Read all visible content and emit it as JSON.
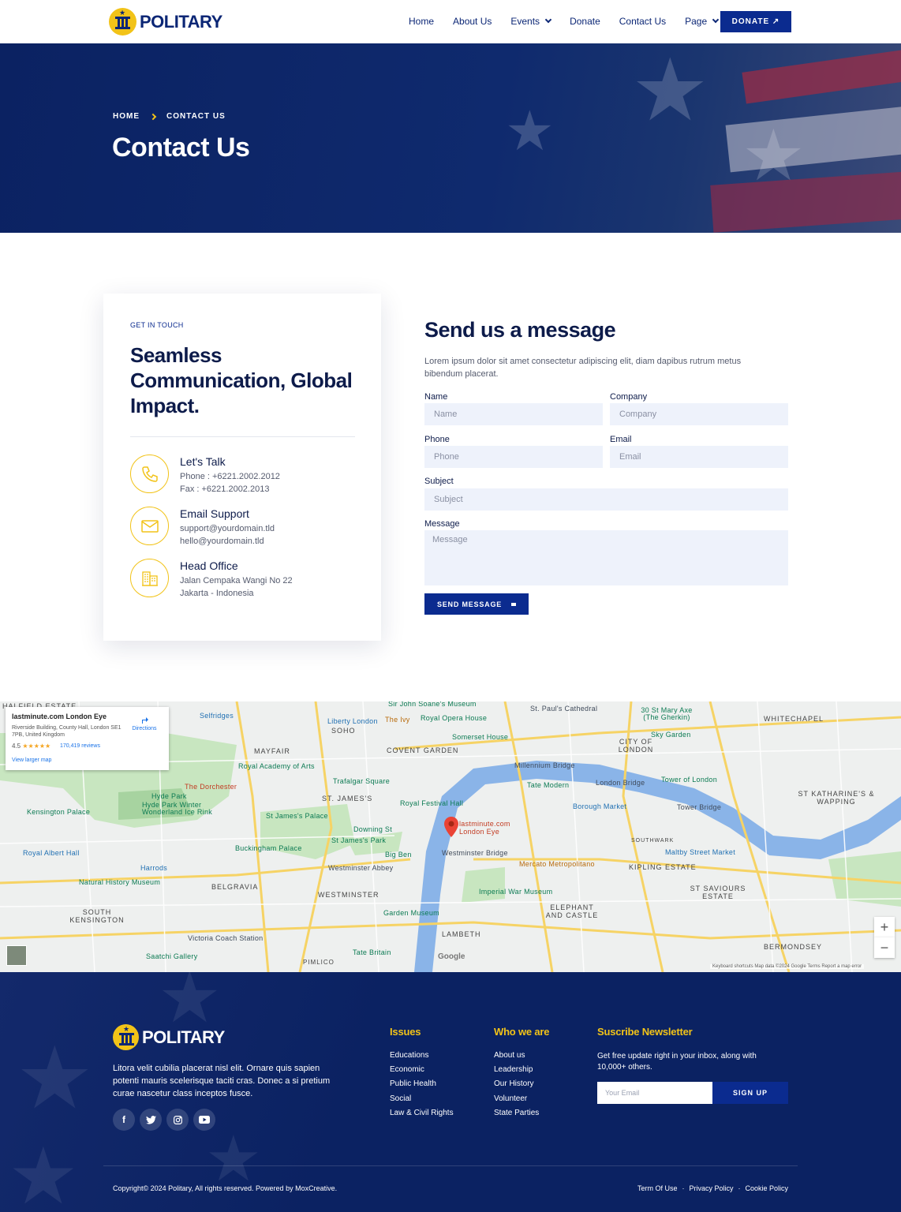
{
  "brand": {
    "name": "POLITARY"
  },
  "nav": {
    "items": [
      {
        "label": "Home",
        "dropdown": false
      },
      {
        "label": "About Us",
        "dropdown": false
      },
      {
        "label": "Events",
        "dropdown": true
      },
      {
        "label": "Donate",
        "dropdown": false
      },
      {
        "label": "Contact Us",
        "dropdown": false
      },
      {
        "label": "Page",
        "dropdown": true
      }
    ],
    "donate_label": "DONATE ↗"
  },
  "hero": {
    "breadcrumb": [
      "HOME",
      "CONTACT US"
    ],
    "title": "Contact Us"
  },
  "contact_card": {
    "eyebrow": "GET IN TOUCH",
    "heading": "Seamless Communication, Global Impact.",
    "items": [
      {
        "icon": "phone-icon",
        "title": "Let's Talk",
        "line1": "Phone : +6221.2002.2012",
        "line2": "Fax : +6221.2002.2013"
      },
      {
        "icon": "mail-icon",
        "title": "Email Support",
        "line1": "support@yourdomain.tld",
        "line2": "hello@yourdomain.tld"
      },
      {
        "icon": "building-icon",
        "title": "Head Office",
        "line1": "Jalan Cempaka Wangi No 22",
        "line2": "Jakarta - Indonesia"
      }
    ]
  },
  "form": {
    "title": "Send us a message",
    "description": "Lorem ipsum dolor sit amet consectetur adipiscing elit, diam dapibus rutrum metus bibendum placerat.",
    "fields": {
      "name": {
        "label": "Name",
        "placeholder": "Name"
      },
      "company": {
        "label": "Company",
        "placeholder": "Company"
      },
      "phone": {
        "label": "Phone",
        "placeholder": "Phone"
      },
      "email": {
        "label": "Email",
        "placeholder": "Email"
      },
      "subject": {
        "label": "Subject",
        "placeholder": "Subject"
      },
      "message": {
        "label": "Message",
        "placeholder": "Message"
      }
    },
    "submit_label": "SEND MESSAGE"
  },
  "map": {
    "place_name": "lastminute.com London Eye",
    "address": "Riverside Building, County Hall, London SE1 7PB, United Kingdom",
    "rating": "4.5",
    "stars": "★★★★★",
    "reviews": "170,419 reviews",
    "directions_label": "Directions",
    "view_larger": "View larger map",
    "pin_label": "lastminute.com London Eye",
    "zoom_in": "+",
    "zoom_out": "−",
    "footer": "Keyboard shortcuts    Map data ©2024 Google    Terms    Report a map error",
    "google": "Google",
    "labels": {
      "halfield": "HALFIELD ESTATE",
      "soho": "SOHO",
      "mayfair": "MAYFAIR",
      "covent": "COVENT GARDEN",
      "whitechapel": "WHITECHAPEL",
      "city": "CITY OF LONDON",
      "stjames": "ST. JAMES'S",
      "stkath": "ST KATHARINE'S & WAPPING",
      "southwark": "SOUTHWARK",
      "kipling": "KIPLING ESTATE",
      "belgravia": "BELGRAVIA",
      "westminster": "WESTMINSTER",
      "southken": "SOUTH KENSINGTON",
      "elephant": "ELEPHANT AND CASTLE",
      "stsaviours": "ST SAVIOURS ESTATE",
      "lambeth": "LAMBETH",
      "bermondsey": "BERMONDSEY",
      "pimlico": "PIMLICO",
      "selfridges": "Selfridges",
      "libertylondon": "Liberty London",
      "royalopera": "Royal Opera House",
      "theivy": "The Ivy",
      "somerset": "Somerset House",
      "stpauls": "St. Paul's Cathedral",
      "stmaryaxe": "30 St Mary Axe (The Gherkin)",
      "skygarden": "Sky Garden",
      "royalacademy": "Royal Academy of Arts",
      "dorchester": "The Dorchester",
      "hydepark": "Hyde Park",
      "hydeparkwinter": "Hyde Park Winter Wonderland Ice Rink",
      "trafalgar": "Trafalgar Square",
      "millennium": "Millennium Bridge",
      "tatemodern": "Tate Modern",
      "londonbridge": "London Bridge",
      "toweroflondon": "Tower of London",
      "kensington": "Kensington Palace",
      "stjamespalace": "St James's Palace",
      "royalfestival": "Royal Festival Hall",
      "boroughmarket": "Borough Market",
      "towerbridge": "Tower Bridge",
      "downing": "Downing St",
      "stjamespark": "St James's Park",
      "buckingham": "Buckingham Palace",
      "royalalbert": "Royal Albert Hall",
      "bigben": "Big Ben",
      "westminsterbridge": "Westminster Bridge",
      "harrods": "Harrods",
      "westminsterabbey": "Westminster Abbey",
      "mercato": "Mercato Metropolitano",
      "maltby": "Maltby Street Market",
      "naturalhistory": "Natural History Museum",
      "imperialwar": "Imperial War Museum",
      "gardenmuseum": "Garden Museum",
      "victoriacoach": "Victoria Coach Station",
      "saatchi": "Saatchi Gallery",
      "tatebritain": "Tate Britain",
      "sirjohn": "Sir John Soane's Museum"
    }
  },
  "footer": {
    "brand": "POLITARY",
    "about": "Litora velit cubilia placerat nisl elit. Ornare quis sapien potenti mauris scelerisque taciti cras. Donec a si pretium curae nascetur class inceptos fusce.",
    "socials": [
      "facebook-icon",
      "twitter-icon",
      "instagram-icon",
      "youtube-icon"
    ],
    "columns": [
      {
        "title": "Issues",
        "items": [
          "Educations",
          "Economic",
          "Public Health",
          "Social",
          "Law & Civil Rights"
        ]
      },
      {
        "title": "Who we are",
        "items": [
          "About us",
          "Leadership",
          "Our History",
          "Volunteer",
          "State Parties"
        ]
      }
    ],
    "newsletter": {
      "title": "Suscribe Newsletter",
      "description": "Get free update right in your inbox, along with 10,000+ others.",
      "placeholder": "Your Email",
      "button": "SIGN UP"
    },
    "copyright": "Copyright© 2024 Politary, All rights reserved. Powered by MoxCreative.",
    "legal": [
      "Term Of Use",
      "Privacy Policy",
      "Cookie Policy"
    ]
  },
  "colors": {
    "primary": "#0b2b8f",
    "navy": "#0b2262",
    "accent": "#f2c318",
    "input_bg": "#eef2fb"
  }
}
